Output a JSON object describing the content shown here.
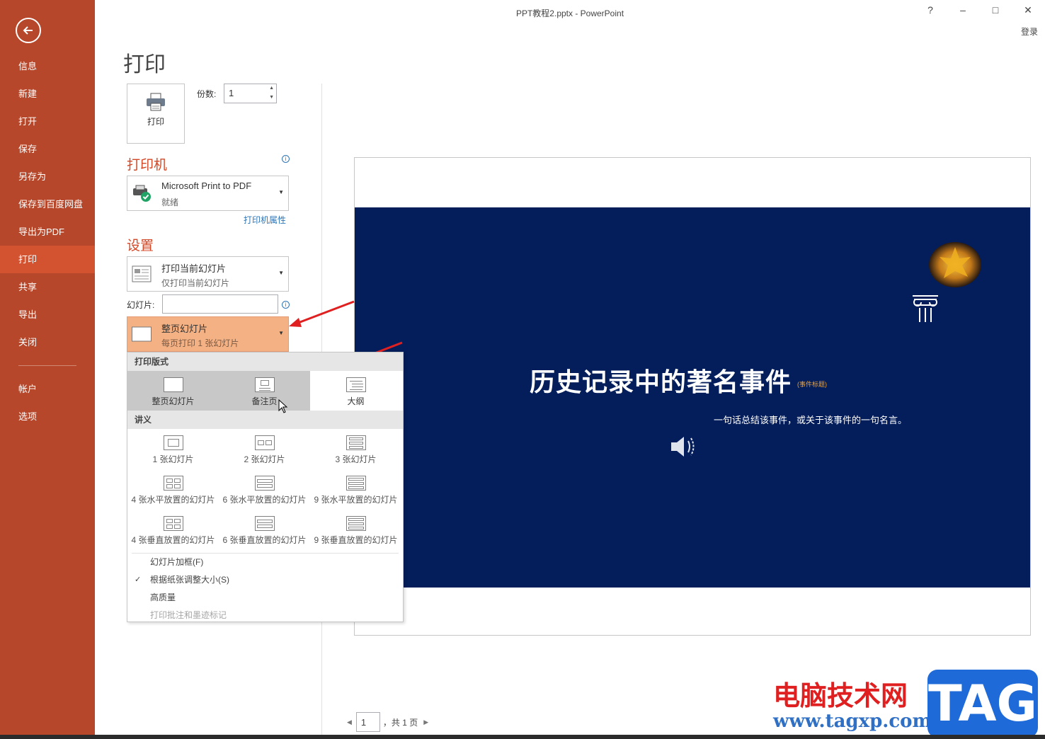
{
  "window": {
    "title": "PPT教程2.pptx - PowerPoint",
    "help": "?",
    "minimize": "–",
    "maximize": "□",
    "close": "✕",
    "signin": "登录"
  },
  "sidebar": {
    "items": [
      {
        "label": "信息"
      },
      {
        "label": "新建"
      },
      {
        "label": "打开"
      },
      {
        "label": "保存"
      },
      {
        "label": "另存为"
      },
      {
        "label": "保存到百度网盘"
      },
      {
        "label": "导出为PDF"
      },
      {
        "label": "打印",
        "active": true
      },
      {
        "label": "共享"
      },
      {
        "label": "导出"
      },
      {
        "label": "关闭"
      }
    ],
    "bottom_items": [
      {
        "label": "帐户"
      },
      {
        "label": "选项"
      }
    ]
  },
  "print": {
    "page_title": "打印",
    "button_label": "打印",
    "copies_label": "份数:",
    "copies_value": "1"
  },
  "printer": {
    "heading": "打印机",
    "name": "Microsoft Print to PDF",
    "status": "就绪",
    "properties_link": "打印机属性"
  },
  "settings": {
    "heading": "设置",
    "range_main": "打印当前幻灯片",
    "range_sub": "仅打印当前幻灯片",
    "slides_label": "幻灯片:",
    "slides_value": "",
    "layout_main": "整页幻灯片",
    "layout_sub": "每页打印 1 张幻灯片"
  },
  "layout_menu": {
    "section1": "打印版式",
    "layouts": [
      {
        "label": "整页幻灯片",
        "icon": "full-page-slide-icon"
      },
      {
        "label": "备注页",
        "icon": "notes-page-icon"
      },
      {
        "label": "大纲",
        "icon": "outline-icon"
      }
    ],
    "section2": "讲义",
    "handouts": [
      {
        "label": "1 张幻灯片"
      },
      {
        "label": "2 张幻灯片"
      },
      {
        "label": "3 张幻灯片"
      },
      {
        "label": "4 张水平放置的幻灯片"
      },
      {
        "label": "6 张水平放置的幻灯片"
      },
      {
        "label": "9 张水平放置的幻灯片"
      },
      {
        "label": "4 张垂直放置的幻灯片"
      },
      {
        "label": "6 张垂直放置的幻灯片"
      },
      {
        "label": "9 张垂直放置的幻灯片"
      }
    ],
    "options": [
      {
        "label": "幻灯片加框(F)",
        "checked": false,
        "disabled": false
      },
      {
        "label": "根据纸张调整大小(S)",
        "checked": true,
        "disabled": false
      },
      {
        "label": "高质量",
        "checked": false,
        "disabled": false
      },
      {
        "label": "打印批注和墨迹标记",
        "checked": false,
        "disabled": true
      }
    ]
  },
  "preview": {
    "slide_title": "历史记录中的著名事件",
    "slide_tag": "(事件标题)",
    "slide_subtitle": "一句话总结该事件，或关于该事件的一句名言。",
    "slide_bg": "#041e5b"
  },
  "pager": {
    "page_value": "1",
    "total_text": "，共 1 页"
  },
  "watermark": {
    "text": "电脑技术网",
    "url": "www.tagxp.com",
    "logo": "TAG"
  },
  "colors": {
    "sidebar": "#b7472a",
    "sidebar_active": "#d35230",
    "accent": "#d24726",
    "highlight": "#f4b183"
  }
}
